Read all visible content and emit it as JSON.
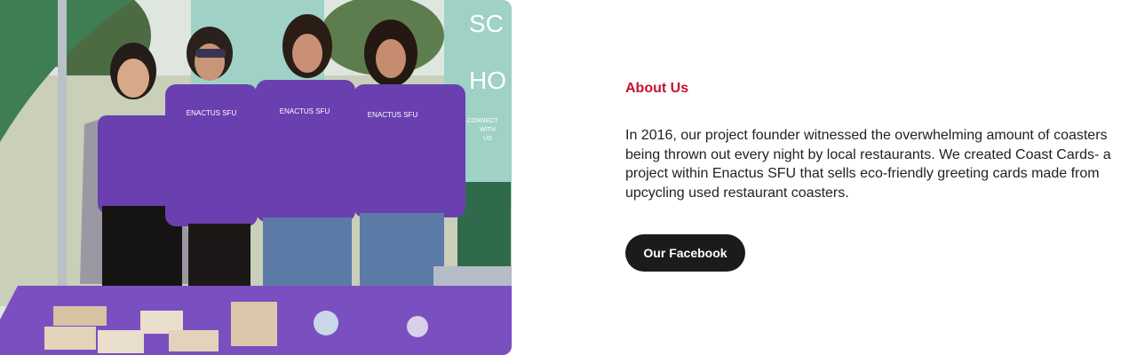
{
  "photo": {
    "alt": "Four Enactus SFU team members in purple shirts standing behind a table of coaster greeting cards",
    "shirt_text": "ENACTUS SFU",
    "banner_letters": [
      "SC",
      "HO"
    ],
    "banner_small": [
      "CONNECT",
      "WITH",
      "US"
    ]
  },
  "about": {
    "heading": "About Us",
    "body": "In 2016, our project founder witnessed the overwhelming amount of coasters being thrown out every night by local restaurants. We created Coast Cards- a project within Enactus SFU that sells eco-friendly greeting cards made from upcycling used restaurant coasters."
  },
  "cta": {
    "label": "Our Facebook"
  },
  "colors": {
    "heading": "#c8102e",
    "button_bg": "#1b1b1b",
    "shirt": "#6a3fb0",
    "tablecloth": "#7a4fc0"
  }
}
